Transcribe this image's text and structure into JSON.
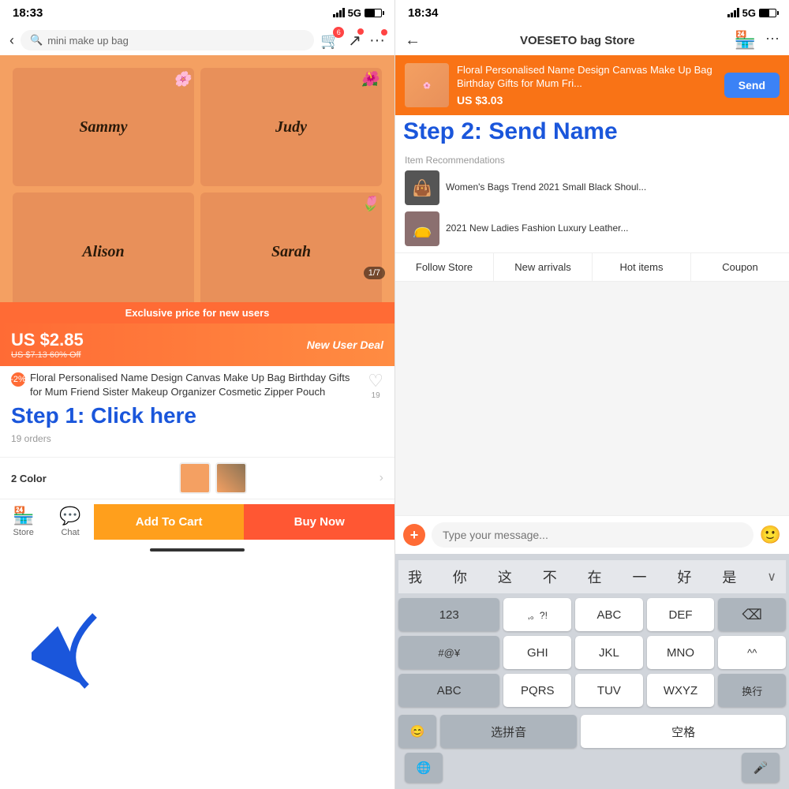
{
  "left_phone": {
    "status_bar": {
      "time": "18:33",
      "signal": "5G",
      "battery_level": "60"
    },
    "header": {
      "search_placeholder": "mini make up bag",
      "cart_badge": "6"
    },
    "product": {
      "image_page": "1/7",
      "exclusive_banner": "Exclusive price for new users",
      "current_price": "US $2.85",
      "original_price": "US $7.13 60% Off",
      "new_user_deal": "New User Deal",
      "discount": "-2%",
      "title": "Floral Personalised Name Design Canvas Make Up Bag Birthday Gifts for Mum Friend Sister Makeup Organizer Cosmetic Zipper Pouch",
      "heart_count": "19",
      "orders": "19 orders",
      "color_label": "2 Color",
      "bag_names": [
        "Sammy",
        "Judy",
        "Alison",
        "Sarah"
      ]
    },
    "bottom": {
      "store_label": "Store",
      "chat_label": "Chat",
      "add_to_cart": "Add To Cart",
      "buy_now": "Buy Now"
    },
    "step_text": "Step 1: Click here"
  },
  "right_phone": {
    "status_bar": {
      "time": "18:34",
      "signal": "5G"
    },
    "header": {
      "title": "VOESETO bag Store"
    },
    "product_card": {
      "title": "Floral Personalised Name Design Canvas Make Up Bag Birthday Gifts for Mum Fri...",
      "price": "US $3.03",
      "send_label": "Send"
    },
    "step_text": "Step 2: Send Name",
    "item_recommendations": {
      "label": "Item Recommendations",
      "items": [
        {
          "title": "Women's Bags Trend 2021 Small Black Shoul...",
          "img_color": "#555"
        },
        {
          "title": "2021 New Ladies Fashion Luxury Leather...",
          "img_color": "#8b6f6f"
        }
      ]
    },
    "store_actions": {
      "follow": "Follow Store",
      "new_arrivals": "New arrivals",
      "hot_items": "Hot items",
      "coupon": "Coupon"
    },
    "message_input": {
      "placeholder": "Type your message..."
    },
    "keyboard": {
      "suggestions": [
        "我",
        "你",
        "这",
        "不",
        "在",
        "一",
        "好",
        "是"
      ],
      "row1": [
        "123",
        ",。?!",
        "ABC",
        "DEF",
        "⌫"
      ],
      "row2": [
        "#@¥",
        "GHI",
        "JKL",
        "MNO",
        "^^"
      ],
      "row3": [
        "ABC",
        "PQRS",
        "TUV",
        "WXYZ",
        "换行"
      ],
      "row4_left": "😊",
      "row4_mid": "选拼音",
      "row4_space": "空格",
      "globe": "🌐",
      "mic": "🎤"
    }
  }
}
